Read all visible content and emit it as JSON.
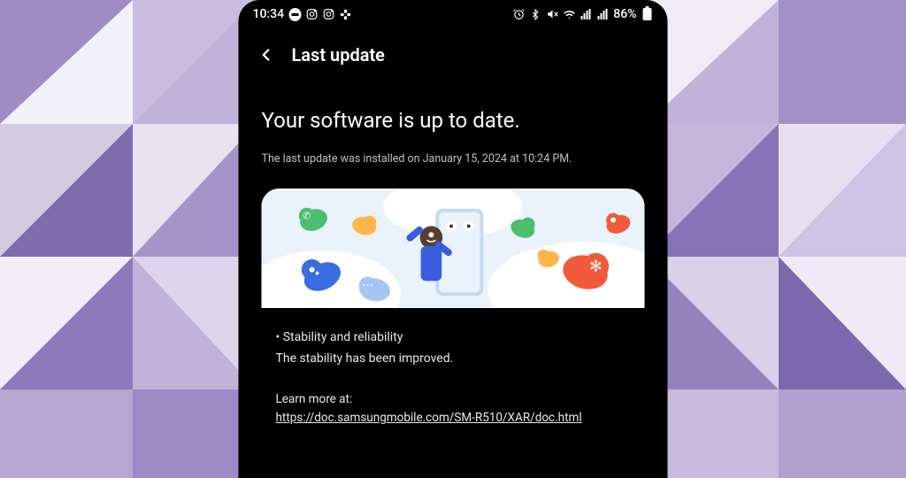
{
  "status_bar": {
    "time": "10:34",
    "battery_percent": "86%"
  },
  "header": {
    "title": "Last update"
  },
  "main": {
    "title": "Your software is up to date.",
    "subtitle": "The last update was installed on January 15, 2024 at 10:24 PM."
  },
  "release_notes": {
    "bullet1": "• Stability and reliability",
    "body1": "The stability has been improved.",
    "learn_more_label": "Learn more at:",
    "learn_more_url": "https://doc.samsungmobile.com/SM-R510/XAR/doc.html"
  }
}
